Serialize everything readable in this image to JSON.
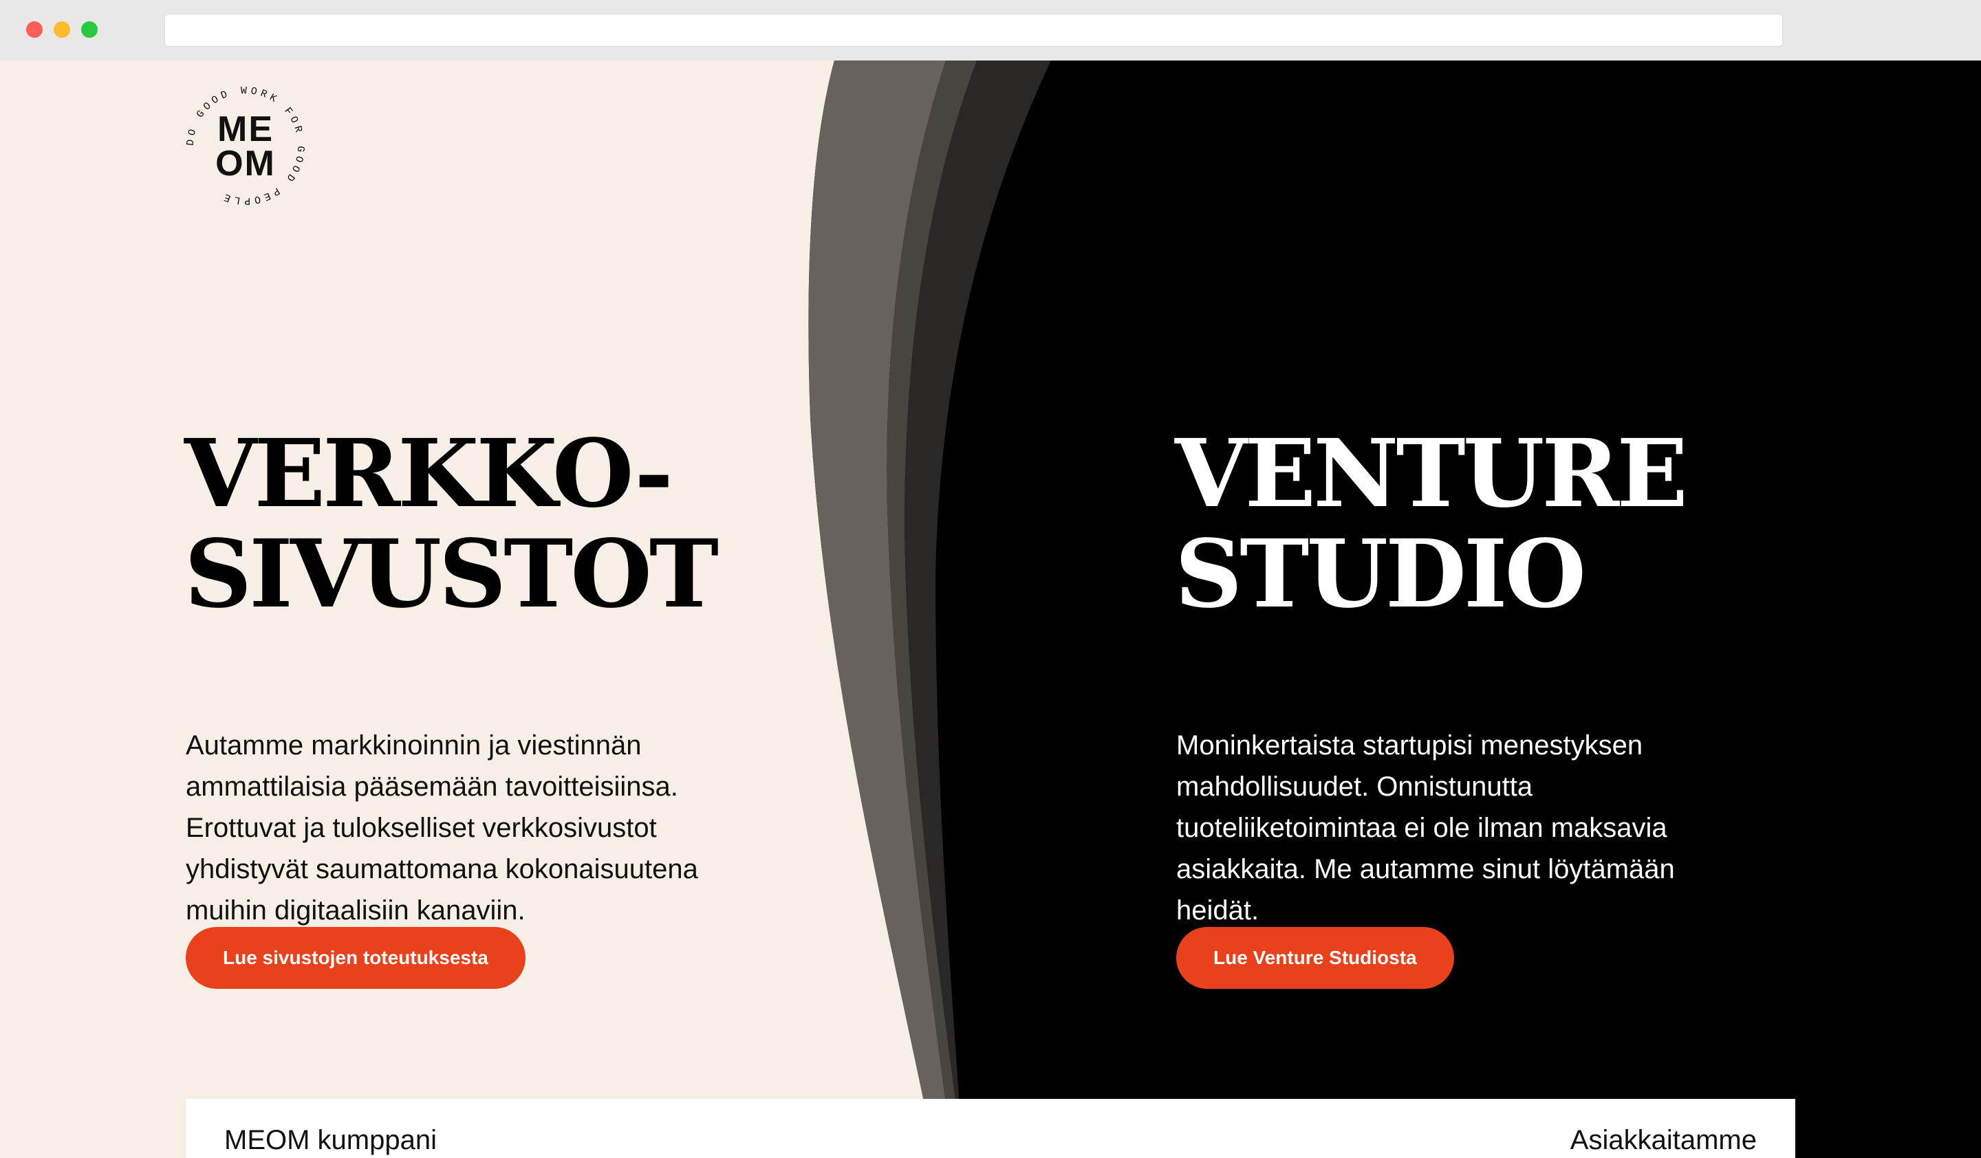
{
  "logo": {
    "line1": "ME",
    "line2": "OM",
    "ring_text": "DO GOOD WORK FOR GOOD PEOPLE"
  },
  "colors": {
    "cream": "#f7efe6",
    "black": "#000000",
    "accent": "#e8411b"
  },
  "left": {
    "heading_line1": "VERKKO-",
    "heading_line2": "SIVUSTOT",
    "body": "Autamme markkinoinnin ja viestinnän ammattilaisia pääsemään tavoitteisiinsa. Erottuvat ja tulokselliset verkkosivustot yhdistyvät saumattomana kokonaisuutena muihin digitaalisiin kanaviin.",
    "cta": "Lue sivustojen toteutuksesta"
  },
  "right": {
    "heading_line1": "VENTURE",
    "heading_line2": "STUDIO",
    "body": "Moninkertaista startupisi menestyksen mahdollisuudet. Onnistunutta tuoteliiketoimintaa ei ole ilman maksavia asiakkaita. Me autamme sinut löytämään heidät.",
    "cta": "Lue Venture Studiosta"
  },
  "bottom": {
    "left_partial": "MEOM kumppani",
    "right_partial": "Asiakkaitamme"
  }
}
